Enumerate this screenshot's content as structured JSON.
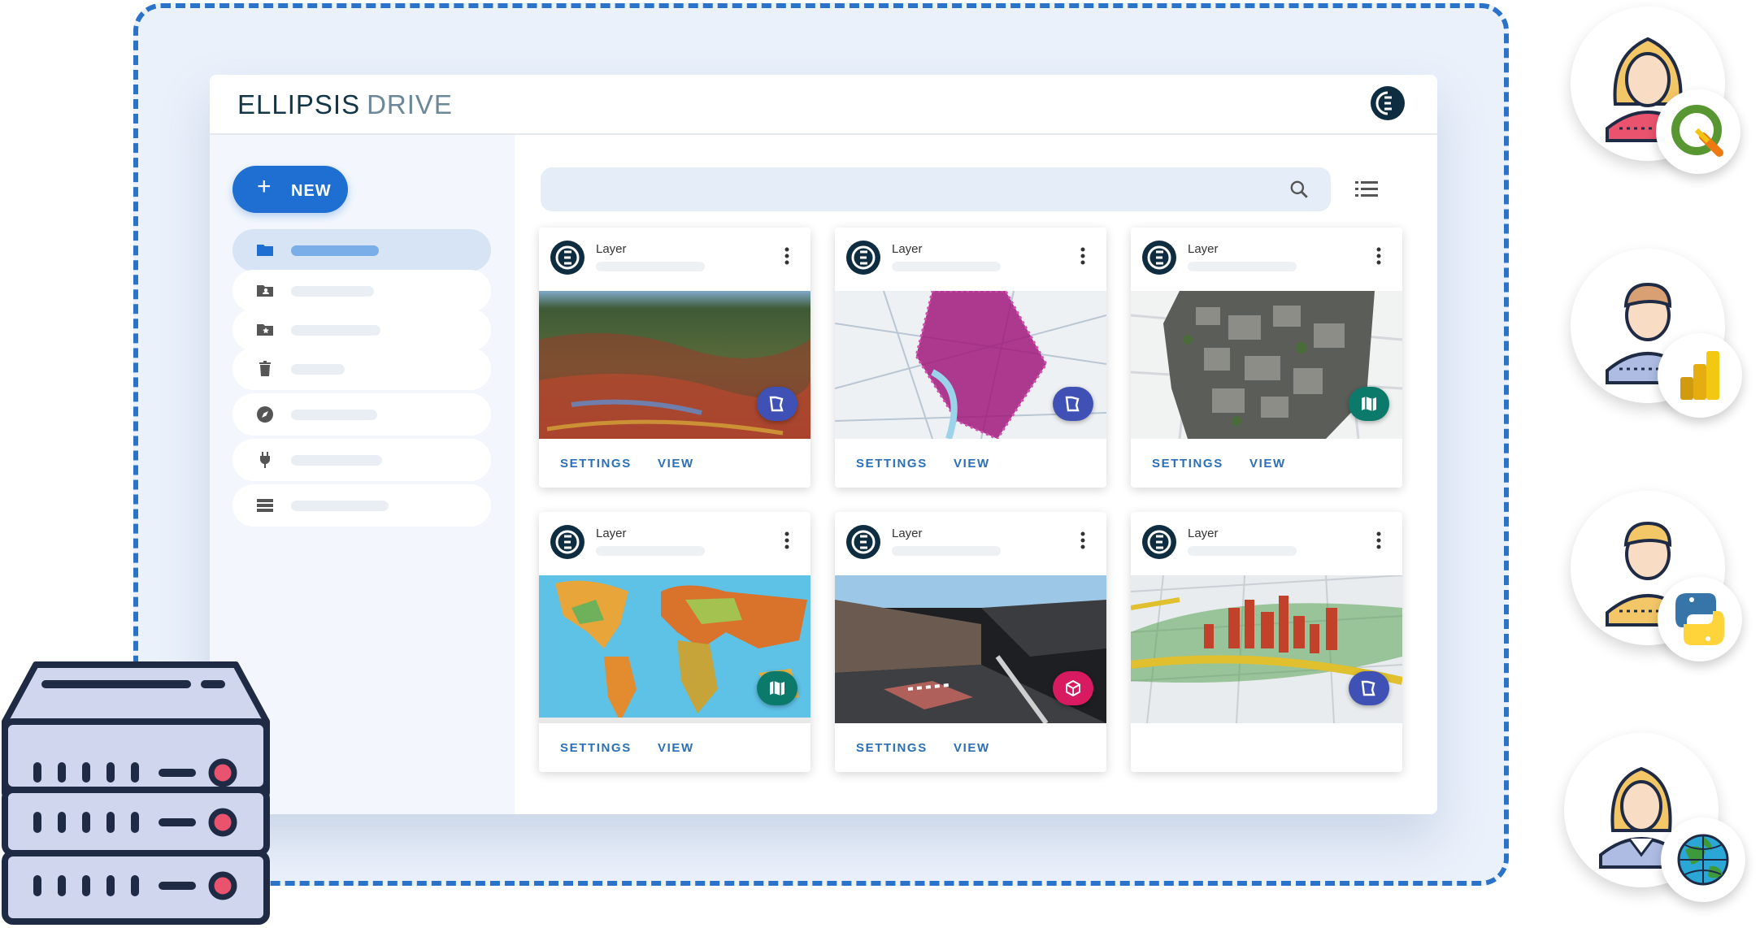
{
  "header": {
    "logo_main": "ELLIPSIS",
    "logo_sub": "DRIVE"
  },
  "sidebar": {
    "new_button_label": "NEW",
    "new_button_icon": "plus-icon",
    "items": [
      {
        "icon": "folder-icon",
        "active": true
      },
      {
        "icon": "shared-folder-icon",
        "active": false
      },
      {
        "icon": "favorites-folder-icon",
        "active": false
      },
      {
        "icon": "trash-icon",
        "active": false
      },
      {
        "icon": "explore-compass-icon",
        "active": false
      },
      {
        "icon": "plug-icon",
        "active": false
      },
      {
        "icon": "storage-icon",
        "active": false
      }
    ]
  },
  "toolbar": {
    "search_icon": "search-icon",
    "view_toggle_icon": "list-view-icon"
  },
  "cards": [
    {
      "title": "Layer",
      "badge": "vector-layer-icon",
      "badge_color": "#3f51b5",
      "settings": "SETTINGS",
      "view": "VIEW"
    },
    {
      "title": "Layer",
      "badge": "vector-layer-icon",
      "badge_color": "#3f51b5",
      "settings": "SETTINGS",
      "view": "VIEW"
    },
    {
      "title": "Layer",
      "badge": "raster-map-icon",
      "badge_color": "#0b7a6a",
      "settings": "SETTINGS",
      "view": "VIEW"
    },
    {
      "title": "Layer",
      "badge": "raster-map-icon",
      "badge_color": "#0b7a6a",
      "settings": "SETTINGS",
      "view": "VIEW"
    },
    {
      "title": "Layer",
      "badge": "3d-cube-icon",
      "badge_color": "#d81b60",
      "settings": "SETTINGS",
      "view": "VIEW"
    },
    {
      "title": "Layer",
      "badge": "vector-layer-icon",
      "badge_color": "#3f51b5",
      "settings": "",
      "view": ""
    }
  ],
  "integrations": [
    {
      "person": "female-analyst-avatar",
      "tool": "qgis-logo"
    },
    {
      "person": "male-analyst-avatar",
      "tool": "power-bi-logo"
    },
    {
      "person": "developer-avatar",
      "tool": "python-logo"
    },
    {
      "person": "businesswoman-avatar",
      "tool": "arcgis-globe-logo"
    }
  ],
  "colors": {
    "accent": "#1e6fd1",
    "dashed_border": "#2a73c9",
    "navy": "#0f2d40"
  }
}
